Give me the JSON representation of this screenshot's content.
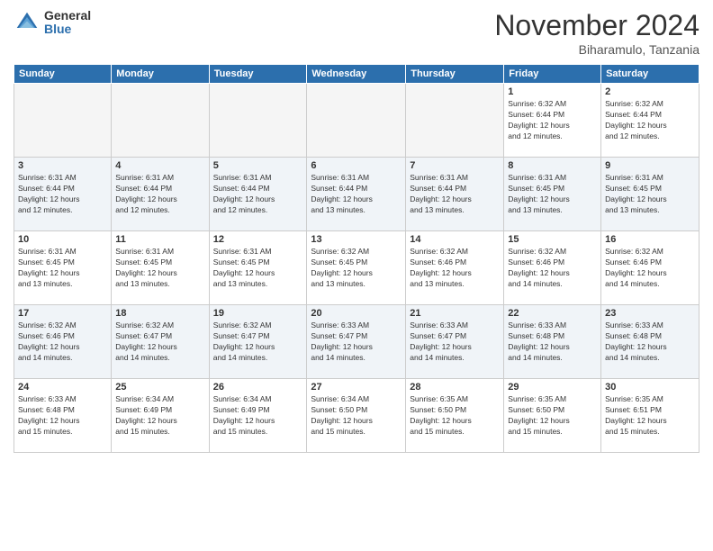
{
  "header": {
    "logo_general": "General",
    "logo_blue": "Blue",
    "month_title": "November 2024",
    "subtitle": "Biharamulo, Tanzania"
  },
  "weekdays": [
    "Sunday",
    "Monday",
    "Tuesday",
    "Wednesday",
    "Thursday",
    "Friday",
    "Saturday"
  ],
  "weeks": [
    [
      {
        "day": "",
        "info": ""
      },
      {
        "day": "",
        "info": ""
      },
      {
        "day": "",
        "info": ""
      },
      {
        "day": "",
        "info": ""
      },
      {
        "day": "",
        "info": ""
      },
      {
        "day": "1",
        "info": "Sunrise: 6:32 AM\nSunset: 6:44 PM\nDaylight: 12 hours\nand 12 minutes."
      },
      {
        "day": "2",
        "info": "Sunrise: 6:32 AM\nSunset: 6:44 PM\nDaylight: 12 hours\nand 12 minutes."
      }
    ],
    [
      {
        "day": "3",
        "info": "Sunrise: 6:31 AM\nSunset: 6:44 PM\nDaylight: 12 hours\nand 12 minutes."
      },
      {
        "day": "4",
        "info": "Sunrise: 6:31 AM\nSunset: 6:44 PM\nDaylight: 12 hours\nand 12 minutes."
      },
      {
        "day": "5",
        "info": "Sunrise: 6:31 AM\nSunset: 6:44 PM\nDaylight: 12 hours\nand 12 minutes."
      },
      {
        "day": "6",
        "info": "Sunrise: 6:31 AM\nSunset: 6:44 PM\nDaylight: 12 hours\nand 13 minutes."
      },
      {
        "day": "7",
        "info": "Sunrise: 6:31 AM\nSunset: 6:44 PM\nDaylight: 12 hours\nand 13 minutes."
      },
      {
        "day": "8",
        "info": "Sunrise: 6:31 AM\nSunset: 6:45 PM\nDaylight: 12 hours\nand 13 minutes."
      },
      {
        "day": "9",
        "info": "Sunrise: 6:31 AM\nSunset: 6:45 PM\nDaylight: 12 hours\nand 13 minutes."
      }
    ],
    [
      {
        "day": "10",
        "info": "Sunrise: 6:31 AM\nSunset: 6:45 PM\nDaylight: 12 hours\nand 13 minutes."
      },
      {
        "day": "11",
        "info": "Sunrise: 6:31 AM\nSunset: 6:45 PM\nDaylight: 12 hours\nand 13 minutes."
      },
      {
        "day": "12",
        "info": "Sunrise: 6:31 AM\nSunset: 6:45 PM\nDaylight: 12 hours\nand 13 minutes."
      },
      {
        "day": "13",
        "info": "Sunrise: 6:32 AM\nSunset: 6:45 PM\nDaylight: 12 hours\nand 13 minutes."
      },
      {
        "day": "14",
        "info": "Sunrise: 6:32 AM\nSunset: 6:46 PM\nDaylight: 12 hours\nand 13 minutes."
      },
      {
        "day": "15",
        "info": "Sunrise: 6:32 AM\nSunset: 6:46 PM\nDaylight: 12 hours\nand 14 minutes."
      },
      {
        "day": "16",
        "info": "Sunrise: 6:32 AM\nSunset: 6:46 PM\nDaylight: 12 hours\nand 14 minutes."
      }
    ],
    [
      {
        "day": "17",
        "info": "Sunrise: 6:32 AM\nSunset: 6:46 PM\nDaylight: 12 hours\nand 14 minutes."
      },
      {
        "day": "18",
        "info": "Sunrise: 6:32 AM\nSunset: 6:47 PM\nDaylight: 12 hours\nand 14 minutes."
      },
      {
        "day": "19",
        "info": "Sunrise: 6:32 AM\nSunset: 6:47 PM\nDaylight: 12 hours\nand 14 minutes."
      },
      {
        "day": "20",
        "info": "Sunrise: 6:33 AM\nSunset: 6:47 PM\nDaylight: 12 hours\nand 14 minutes."
      },
      {
        "day": "21",
        "info": "Sunrise: 6:33 AM\nSunset: 6:47 PM\nDaylight: 12 hours\nand 14 minutes."
      },
      {
        "day": "22",
        "info": "Sunrise: 6:33 AM\nSunset: 6:48 PM\nDaylight: 12 hours\nand 14 minutes."
      },
      {
        "day": "23",
        "info": "Sunrise: 6:33 AM\nSunset: 6:48 PM\nDaylight: 12 hours\nand 14 minutes."
      }
    ],
    [
      {
        "day": "24",
        "info": "Sunrise: 6:33 AM\nSunset: 6:48 PM\nDaylight: 12 hours\nand 15 minutes."
      },
      {
        "day": "25",
        "info": "Sunrise: 6:34 AM\nSunset: 6:49 PM\nDaylight: 12 hours\nand 15 minutes."
      },
      {
        "day": "26",
        "info": "Sunrise: 6:34 AM\nSunset: 6:49 PM\nDaylight: 12 hours\nand 15 minutes."
      },
      {
        "day": "27",
        "info": "Sunrise: 6:34 AM\nSunset: 6:50 PM\nDaylight: 12 hours\nand 15 minutes."
      },
      {
        "day": "28",
        "info": "Sunrise: 6:35 AM\nSunset: 6:50 PM\nDaylight: 12 hours\nand 15 minutes."
      },
      {
        "day": "29",
        "info": "Sunrise: 6:35 AM\nSunset: 6:50 PM\nDaylight: 12 hours\nand 15 minutes."
      },
      {
        "day": "30",
        "info": "Sunrise: 6:35 AM\nSunset: 6:51 PM\nDaylight: 12 hours\nand 15 minutes."
      }
    ]
  ]
}
